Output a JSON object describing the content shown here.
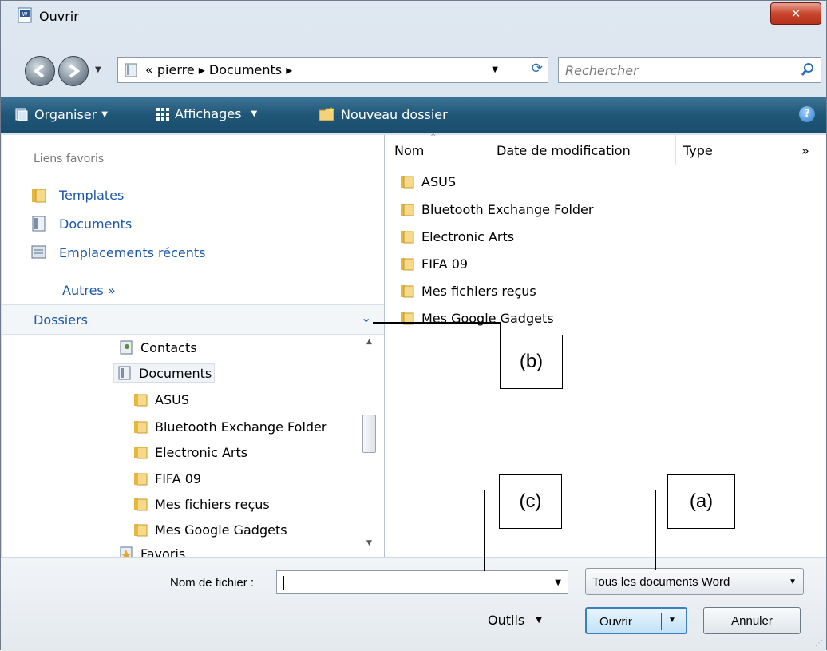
{
  "window": {
    "title": "Ouvrir"
  },
  "address": {
    "segments": "« pierre ▸ Documents ▸",
    "search_placeholder": "Rechercher"
  },
  "toolbar": {
    "organize": "Organiser",
    "views": "Affichages",
    "new_folder": "Nouveau dossier"
  },
  "favorites": {
    "title": "Liens favoris",
    "items": [
      "Templates",
      "Documents",
      "Emplacements récents"
    ],
    "more": "Autres »"
  },
  "folders": {
    "header": "Dossiers",
    "tree": [
      "Contacts",
      "Documents",
      "ASUS",
      "Bluetooth Exchange Folder",
      "Electronic Arts",
      "FIFA 09",
      "Mes fichiers reçus",
      "Mes Google Gadgets",
      "Favoris"
    ]
  },
  "columns": {
    "name": "Nom",
    "date": "Date de modification",
    "type": "Type",
    "more": "»"
  },
  "files": [
    "ASUS",
    "Bluetooth Exchange Folder",
    "Electronic Arts",
    "FIFA 09",
    "Mes fichiers reçus",
    "Mes Google Gadgets"
  ],
  "bottom": {
    "filename_label": "Nom de fichier :",
    "filename_value": "",
    "filetype": "Tous les documents Word",
    "tools": "Outils",
    "open": "Ouvrir",
    "cancel": "Annuler"
  },
  "annotations": {
    "a": "(a)",
    "b": "(b)",
    "c": "(c)"
  }
}
